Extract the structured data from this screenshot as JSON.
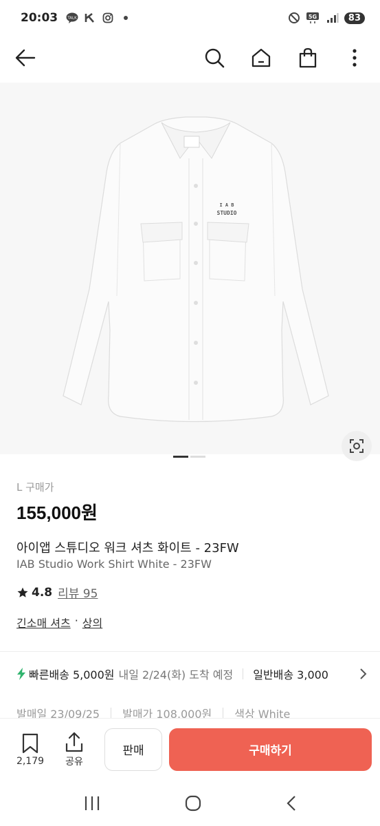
{
  "status_bar": {
    "time": "20:03",
    "left_icons": [
      "talk-icon",
      "k-icon",
      "instagram-icon",
      "dot-icon"
    ],
    "right_icons": [
      "dnd-icon",
      "5g-icon",
      "signal-icon"
    ],
    "network": "5G",
    "battery": "83"
  },
  "nav": {
    "icons": [
      "back-arrow-icon",
      "search-icon",
      "home-icon",
      "shopping-bag-icon",
      "more-vertical-icon"
    ]
  },
  "image": {
    "logo_line1": "I A B",
    "logo_line2": "STUDIO",
    "pagination_total": 2,
    "pagination_active": 1
  },
  "product": {
    "size_label": "L 구매가",
    "price": "155,000원",
    "title_ko": "아이앱 스튜디오 워크 셔츠 화이트 - 23FW",
    "title_en": "IAB Studio Work Shirt White - 23FW",
    "rating": "4.8",
    "review_label": "리뷰 95",
    "category_1": "긴소매 셔츠",
    "category_sep": "·",
    "category_2": "상의"
  },
  "shipping": {
    "fast_label": "빠른배송 5,000원",
    "fast_date": "내일 2/24(화) 도착 예정",
    "general_label": "일반배송 3,000"
  },
  "info": {
    "release": "발매일 23/09/25",
    "release_price": "발매가 108,000원",
    "color": "색상 White"
  },
  "actions": {
    "wish_count": "2,179",
    "share_label": "공유",
    "sell_label": "판매",
    "buy_label": "구매하기"
  },
  "colors": {
    "accent": "#ef6253",
    "lightning": "#31b46e"
  }
}
